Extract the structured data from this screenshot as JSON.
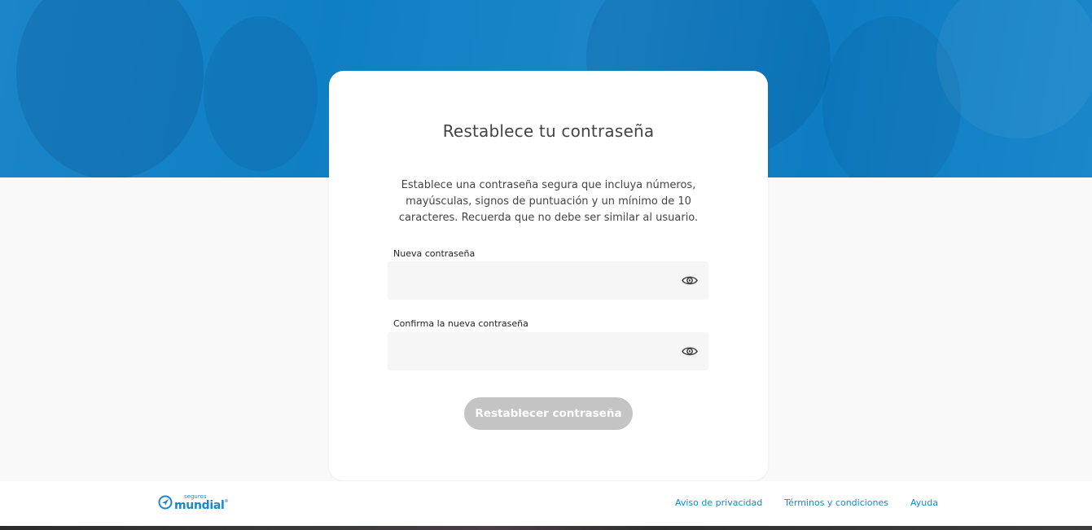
{
  "card": {
    "title": "Restablece tu contraseña",
    "description": "Establece una contraseña segura que incluya números, mayúsculas, signos de puntuación y un mínimo de 10 caracteres. Recuerda que no debe ser similar al usuario.",
    "new_password": {
      "label": "Nueva contraseña",
      "value": "",
      "placeholder": ""
    },
    "confirm_password": {
      "label": "Confirma la nueva contraseña",
      "value": "",
      "placeholder": ""
    },
    "submit_label": "Restablecer contraseña"
  },
  "footer": {
    "logo": {
      "small": "seguros",
      "big": "mundial",
      "mark": "®"
    },
    "links": [
      "Aviso de privacidad",
      "Términos y condiciones",
      "Ayuda"
    ]
  },
  "colors": {
    "brand_blue": "#1a87ca",
    "button_disabled": "#c4c4c4"
  },
  "icons": {
    "password_toggle": "eye-icon",
    "logo": "compass-arrow-icon"
  }
}
